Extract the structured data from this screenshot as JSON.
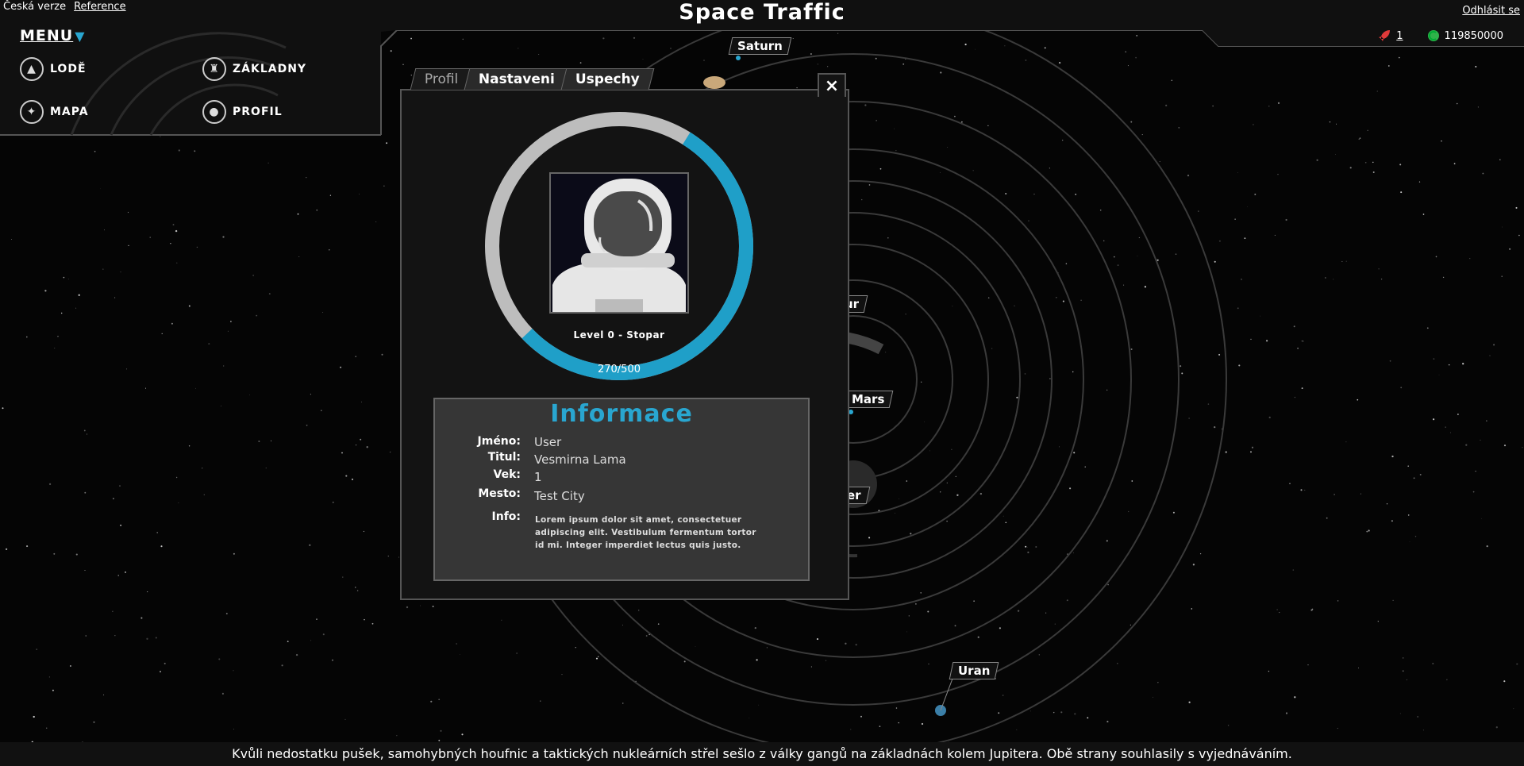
{
  "top": {
    "lang_label": "Česká verze",
    "reference_link": "Reference",
    "title": "Space Traffic",
    "logout_link": "Odhlásit se",
    "rocket_count": "1",
    "credits": "119850000"
  },
  "menu": {
    "title": "MENU",
    "items": [
      {
        "label": "LODĚ",
        "icon": "rocket-icon"
      },
      {
        "label": "ZÁKLADNY",
        "icon": "castle-icon"
      },
      {
        "label": "MAPA",
        "icon": "compass-icon"
      },
      {
        "label": "PROFIL",
        "icon": "user-icon"
      }
    ]
  },
  "planets": {
    "saturn": "Saturn",
    "jupiter_partial": "ur",
    "mars": "Mars",
    "earth_partial": "er",
    "uran": "Uran"
  },
  "modal": {
    "tabs": [
      "Profil",
      "Nastaveni",
      "Uspechy"
    ],
    "active_tab": "Profil",
    "close": "×",
    "level": "Level 0 - Stopar",
    "xp_text": "270/500",
    "xp_fraction": 0.54,
    "info_title": "Informace",
    "fields": [
      {
        "key": "Jméno:",
        "value": "User"
      },
      {
        "key": "Titul:",
        "value": "Vesmirna Lama"
      },
      {
        "key": "Vek:",
        "value": "1"
      },
      {
        "key": "Mesto:",
        "value": "Test City"
      }
    ],
    "info_key": "Info:",
    "info_text": "Lorem ipsum dolor sit amet, consectetuer adipiscing elit. Vestibulum fermentum tortor id mi. Integer imperdiet lectus quis justo."
  },
  "ticker": "Kvůli nedostatku pušek, samohybných houfnic a taktických nukleárních střel sešlo z války gangů na základnách kolem Jupitera. Obě strany souhlasily s vyjednáváním.",
  "colors": {
    "accent": "#29a6d0",
    "rocket": "#e03a3a",
    "credits": "#2fb24a"
  }
}
